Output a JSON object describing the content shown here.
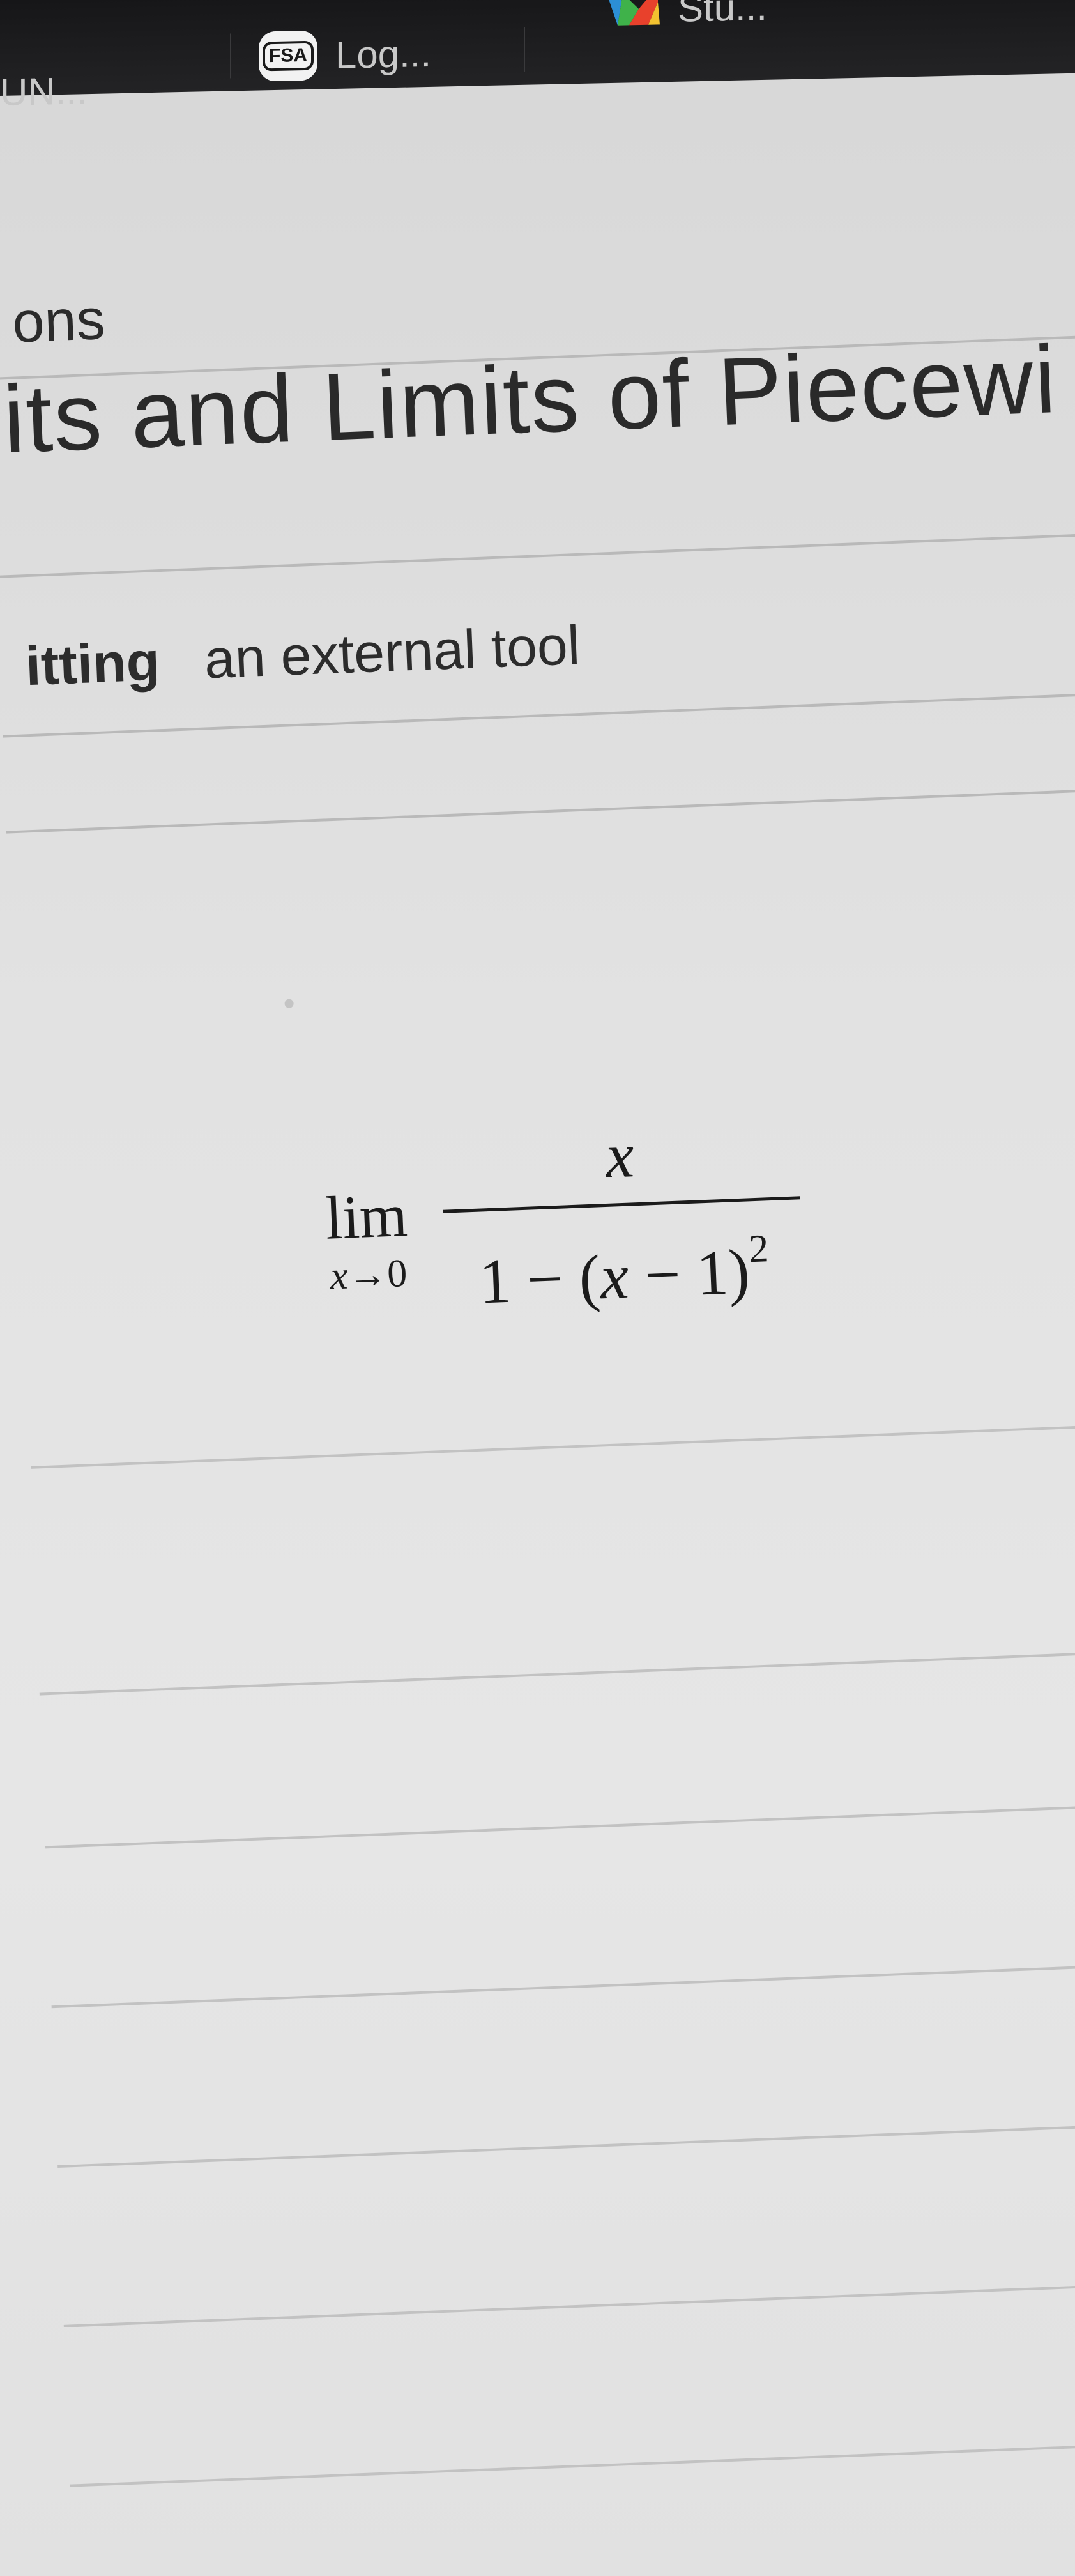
{
  "bookmarks": {
    "item1": {
      "label": "UN..."
    },
    "item2": {
      "badge": "FSA",
      "label": "Log..."
    },
    "item3": {
      "icon": "colorful-logo-icon",
      "label": "Stu..."
    }
  },
  "breadcrumb": {
    "label": "ons"
  },
  "page": {
    "title": "its and Limits of Piecewi"
  },
  "submission": {
    "status": "itting",
    "type": "an external tool"
  },
  "math": {
    "lim": "lim",
    "sub_var": "x",
    "sub_arrow": "→",
    "sub_value": "0",
    "numerator": "x",
    "den_one": "1 − (",
    "den_var": "x",
    "den_rest": " − 1)",
    "den_exp": "2"
  },
  "colors": {
    "bookmark_bar": "#1b1b1d",
    "page_bg": "#e2e2e2",
    "text": "#2a2a2a"
  }
}
